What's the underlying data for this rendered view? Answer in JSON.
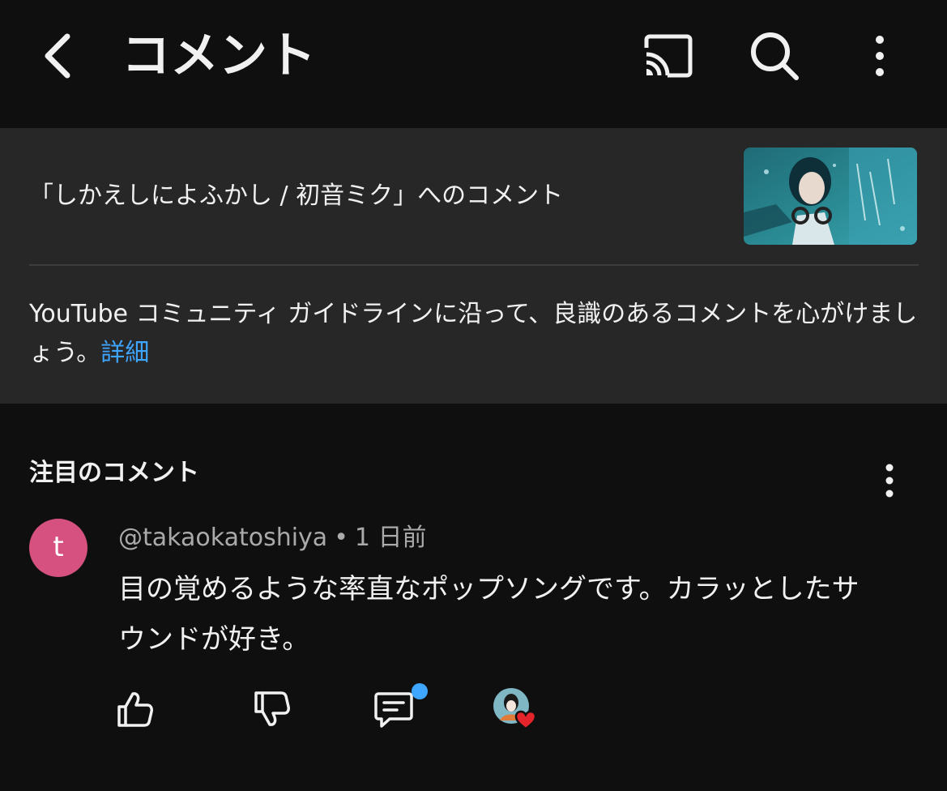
{
  "appbar": {
    "title": "コメント",
    "icons": {
      "back": "back-arrow-icon",
      "cast": "cast-icon",
      "search": "search-icon",
      "more": "more-vertical-icon"
    }
  },
  "context": {
    "video_title_line": "「しかえしによふかし / 初音ミク」へのコメント",
    "guideline_text": "YouTube コミュニティ ガイドラインに沿って、良識のあるコメントを心がけましょう。",
    "guideline_link": "詳細"
  },
  "section": {
    "title": "注目のコメント"
  },
  "comment": {
    "avatar_letter": "t",
    "author": "@takaokatoshiya",
    "separator": "•",
    "time": "1 日前",
    "text": "目の覚めるような率直なポップソングです。カラッとしたサウンドが好き。"
  },
  "actions": {
    "icons": [
      "thumbs-up-icon",
      "thumbs-down-icon",
      "reply-icon",
      "creator-heart-icon"
    ]
  },
  "colors": {
    "background": "#0f0f0f",
    "panel": "#272727",
    "link": "#3ea6ff",
    "avatar": "#d6517f",
    "secondary_text": "#aaaaaa",
    "heart": "#e3242b"
  }
}
